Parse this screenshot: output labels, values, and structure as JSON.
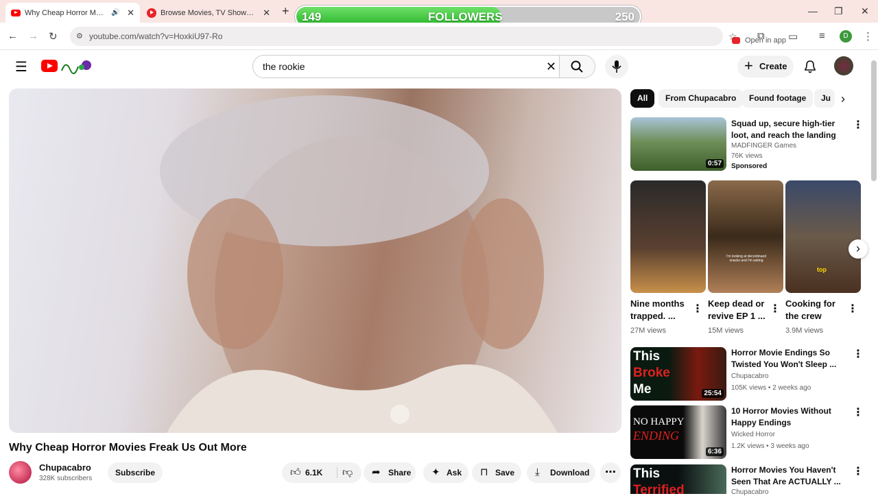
{
  "tabs": [
    {
      "title": "Why Cheap Horror Movies Freak Us Out More",
      "close": "✕",
      "audio": "🔊"
    },
    {
      "title": "Browse Movies, TV Shows - yFlix",
      "close": "✕"
    }
  ],
  "new_tab": "+",
  "followers_widget": {
    "current": "149",
    "label": "FOLLOWERS",
    "goal": "250",
    "progress": 0.596
  },
  "window_controls": {
    "minimize": "—",
    "maximize": "❐",
    "close": "✕"
  },
  "address": {
    "url": "youtube.com/watch?v=HoxkiU97-Ro",
    "open_in_app": "Open in app",
    "profile_initial": "D"
  },
  "header": {
    "search_value": "the rookie",
    "search_clear": "✕",
    "create_label": "Create"
  },
  "video": {
    "title": "Why Cheap Horror Movies Freak Us Out More",
    "channel": "Chupacabro",
    "subscribers": "328K subscribers",
    "subscribe_label": "Subscribe",
    "likes": "6.1K",
    "share_label": "Share",
    "ask_label": "Ask",
    "save_label": "Save",
    "download_label": "Download"
  },
  "chips": [
    "All",
    "From Chupacabro",
    "Found footage",
    "Ju"
  ],
  "recommendations": [
    {
      "title": "Squad up, secure high-tier loot, and reach the landing zone...",
      "channel": "MADFINGER Games",
      "stats": "76K views",
      "badge": "Sponsored",
      "duration": "0:57"
    },
    {
      "title": "Horror Movie Endings So Twisted You Won't Sleep ...",
      "channel": "Chupacabro",
      "stats": "105K views • 2 weeks ago",
      "duration": "25:54",
      "thumb_text": [
        "This",
        "Broke",
        "Me"
      ]
    },
    {
      "title": "10 Horror Movies Without Happy Endings",
      "channel": "Wicked Horror",
      "stats": "1.2K views • 3 weeks ago",
      "duration": "6:36",
      "thumb_text": [
        "NO HAPPY",
        "ENDING"
      ]
    },
    {
      "title": "Horror Movies You Haven't Seen That Are ACTUALLY ...",
      "channel": "Chupacabro",
      "stats": "",
      "duration": "",
      "thumb_text": [
        "This",
        "Terrified"
      ]
    }
  ],
  "shorts": [
    {
      "title": "Nine months trapped. ...",
      "views": "27M views"
    },
    {
      "title": "Keep dead or revive EP 1 ...",
      "views": "15M views",
      "overlay": "I'm looking at decontinued snacks and I'm asking"
    },
    {
      "title": "Cooking for the crew",
      "views": "3.9M views",
      "overlay": "top"
    }
  ]
}
